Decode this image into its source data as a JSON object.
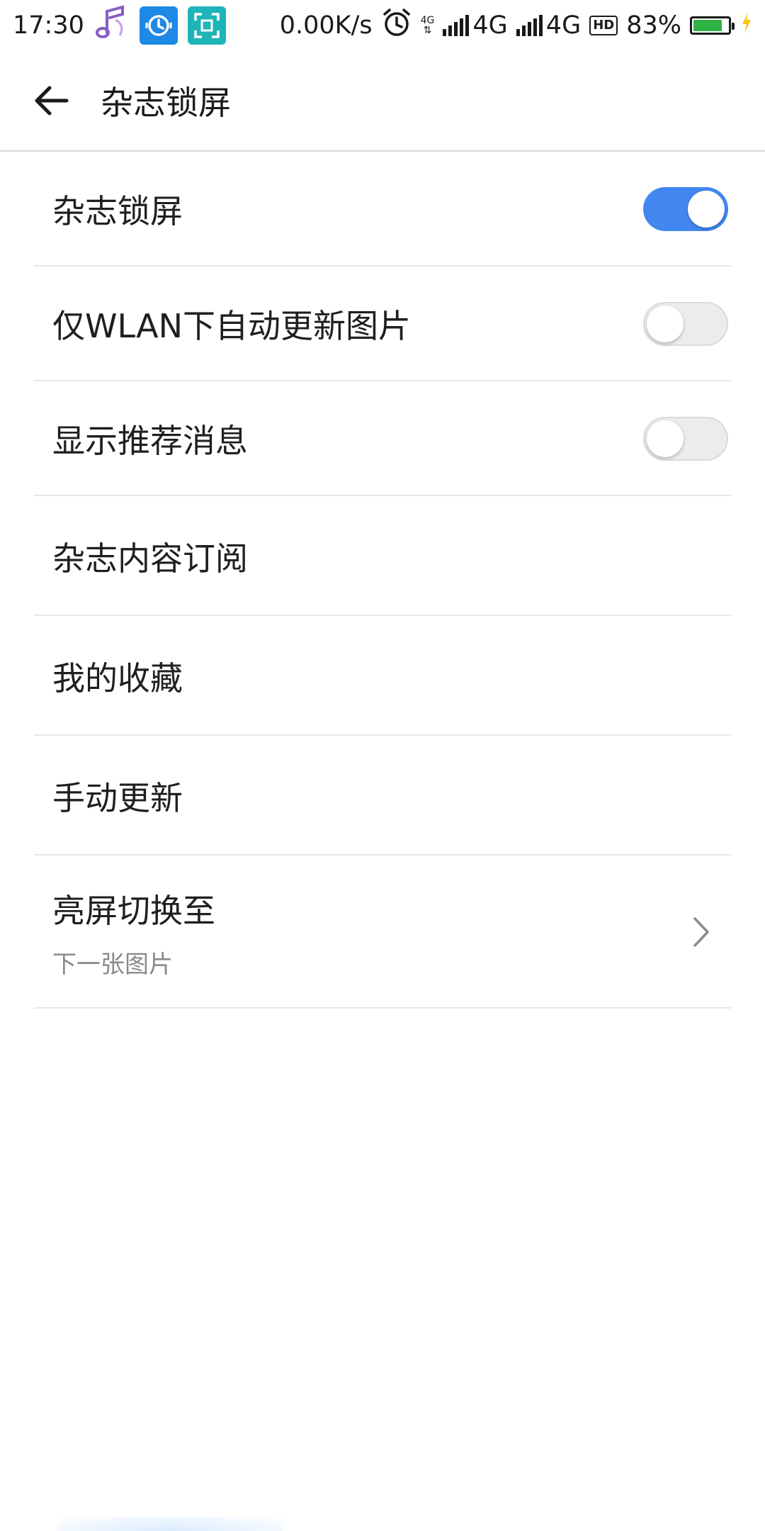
{
  "status_bar": {
    "time": "17:30",
    "net_speed": "0.00K/s",
    "tiny_4g": "4G",
    "tiny_arrows": "⇅",
    "network_1": "4G",
    "network_2": "4G",
    "hd": "HD",
    "battery_percent": "83%",
    "battery_level": 0.83,
    "icons": [
      "music-note-icon",
      "clock-app-icon",
      "scan-app-icon",
      "alarm-icon",
      "data-arrows-icon",
      "signal-icon",
      "battery-icon",
      "charging-icon"
    ]
  },
  "toolbar": {
    "title": "杂志锁屏",
    "back_icon": "arrow-left-icon"
  },
  "settings": [
    {
      "label": "杂志锁屏",
      "toggle": true
    },
    {
      "label": "仅WLAN下自动更新图片",
      "toggle": false
    },
    {
      "label": "显示推荐消息",
      "toggle": false
    },
    {
      "label": "杂志内容订阅"
    },
    {
      "label": "我的收藏"
    },
    {
      "label": "手动更新"
    },
    {
      "label": "亮屏切换至",
      "sub": "下一张图片"
    }
  ],
  "colors": {
    "accent": "#4287f0",
    "battery": "#2fb344",
    "charging": "#f5c518"
  }
}
